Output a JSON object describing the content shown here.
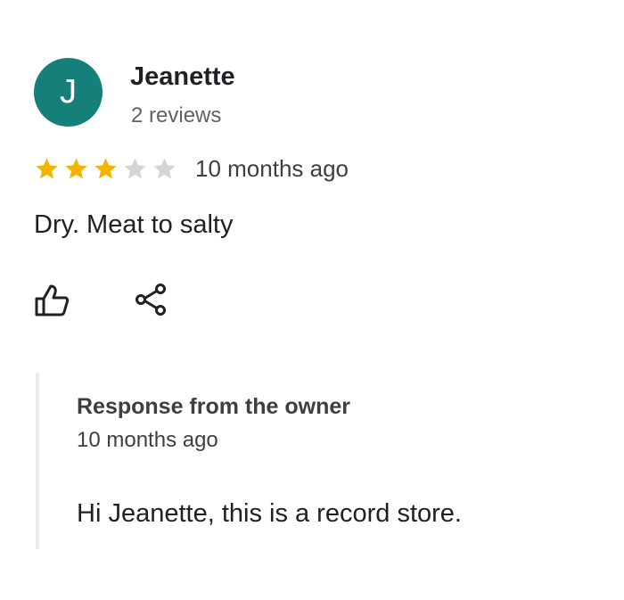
{
  "review": {
    "author": {
      "initial": "J",
      "name": "Jeanette",
      "meta": "2 reviews",
      "avatar_color": "#15807a"
    },
    "rating": {
      "value": 3,
      "max": 5,
      "filled_color": "#f4b400",
      "empty_color": "#d4d4d4"
    },
    "date": "10 months ago",
    "text": "Dry. Meat to salty",
    "actions": [
      {
        "name": "like",
        "icon": "thumbs-up-icon"
      },
      {
        "name": "share",
        "icon": "share-icon"
      }
    ]
  },
  "owner_response": {
    "title": "Response from the owner",
    "date": "10 months ago",
    "text": "Hi Jeanette, this is a record store."
  }
}
